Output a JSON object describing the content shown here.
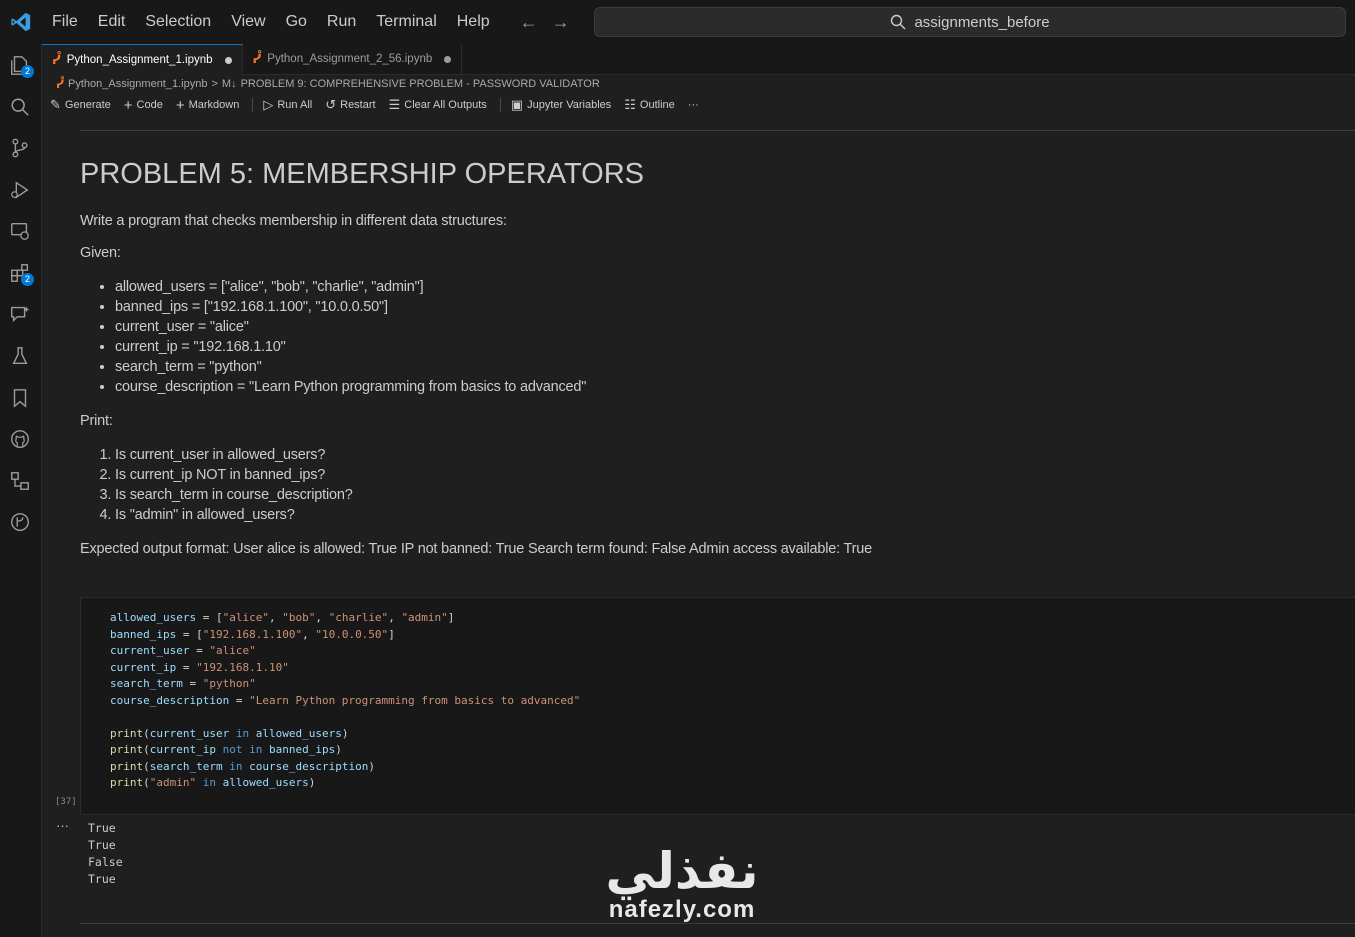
{
  "menu": [
    "File",
    "Edit",
    "Selection",
    "View",
    "Go",
    "Run",
    "Terminal",
    "Help"
  ],
  "search": {
    "text": "assignments_before"
  },
  "activity": {
    "explorer_badge": "2",
    "extensions_badge": "2"
  },
  "tabs": [
    {
      "label": "Python_Assignment_1.ipynb",
      "active": true,
      "modified": true
    },
    {
      "label": "Python_Assignment_2_56.ipynb",
      "active": false,
      "modified": true
    }
  ],
  "breadcrumb": {
    "file": "Python_Assignment_1.ipynb",
    "separator": ">",
    "md_icon": "M↓",
    "section": "PROBLEM 9: COMPREHENSIVE PROBLEM - PASSWORD VALIDATOR"
  },
  "toolbar": {
    "generate": "Generate",
    "code": "Code",
    "markdown": "Markdown",
    "run_all": "Run All",
    "restart": "Restart",
    "clear_outputs": "Clear All Outputs",
    "jupyter_variables": "Jupyter Variables",
    "outline": "Outline",
    "more": "···"
  },
  "markdown": {
    "title": "PROBLEM 5: MEMBERSHIP OPERATORS",
    "intro": "Write a program that checks membership in different data structures:",
    "given_label": "Given:",
    "given": [
      "allowed_users = [\"alice\", \"bob\", \"charlie\", \"admin\"]",
      "banned_ips = [\"192.168.1.100\", \"10.0.0.50\"]",
      "current_user = \"alice\"",
      "current_ip = \"192.168.1.10\"",
      "search_term = \"python\"",
      "course_description = \"Learn Python programming from basics to advanced\""
    ],
    "print_label": "Print:",
    "print_items": [
      "Is current_user in allowed_users?",
      "Is current_ip NOT in banned_ips?",
      "Is search_term in course_description?",
      "Is \"admin\" in allowed_users?"
    ],
    "expected": "Expected output format: User alice is allowed: True IP not banned: True Search term found: False Admin access available: True"
  },
  "code_cell": {
    "exec_count": "[37]",
    "lines": [
      "allowed_users = [\"alice\", \"bob\", \"charlie\", \"admin\"]",
      "banned_ips = [\"192.168.1.100\", \"10.0.0.50\"]",
      "current_user = \"alice\"",
      "current_ip = \"192.168.1.10\"",
      "search_term = \"python\"",
      "course_description = \"Learn Python programming from basics to advanced\"",
      "",
      "print(current_user in allowed_users)",
      "print(current_ip not in banned_ips)",
      "print(search_term in course_description)",
      "print(\"admin\" in allowed_users)"
    ]
  },
  "output": {
    "marker": "···",
    "lines": [
      "True",
      "True",
      "False",
      "True"
    ]
  },
  "watermark": {
    "arabic": "نفذلي",
    "latin": "nafezly.com"
  }
}
